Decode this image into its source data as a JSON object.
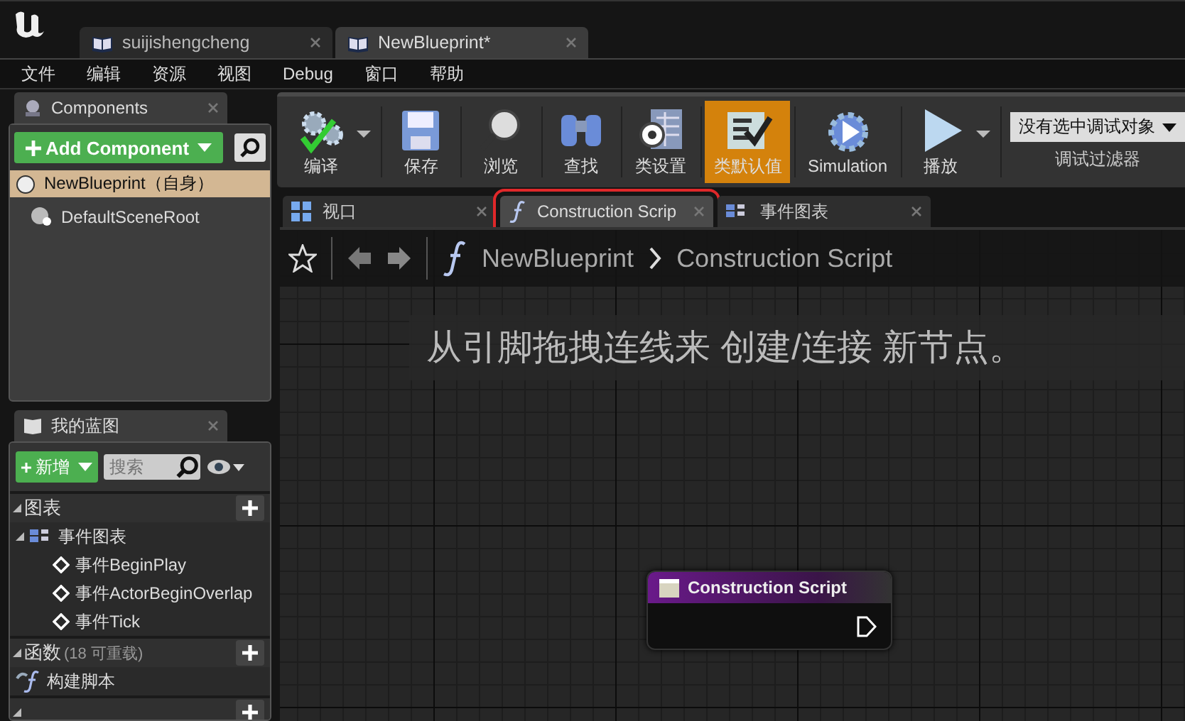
{
  "doc_tabs": [
    {
      "label": "suijishengcheng",
      "selected": false
    },
    {
      "label": "NewBlueprint*",
      "selected": true
    }
  ],
  "menu": [
    "文件",
    "编辑",
    "资源",
    "视图",
    "Debug",
    "窗口",
    "帮助"
  ],
  "components": {
    "title": "Components",
    "add_button": "Add Component",
    "items": [
      {
        "label": "NewBlueprint（自身）",
        "kind": "root",
        "selected": true
      },
      {
        "label": "DefaultSceneRoot",
        "kind": "scene",
        "selected": false
      }
    ]
  },
  "my_blueprint": {
    "title": "我的蓝图",
    "new_button": "新增",
    "search": {
      "placeholder": "搜索"
    },
    "sections": [
      {
        "title": "图表",
        "expanded": true,
        "children": [
          {
            "label": "事件图表",
            "kind": "graph",
            "expanded": true,
            "children": [
              {
                "label": "事件BeginPlay",
                "kind": "event"
              },
              {
                "label": "事件ActorBeginOverlap",
                "kind": "event"
              },
              {
                "label": "事件Tick",
                "kind": "event"
              }
            ]
          }
        ]
      },
      {
        "title": "函数",
        "note": "(18 可重载)",
        "expanded": true,
        "children": [
          {
            "label": "构建脚本",
            "kind": "function"
          }
        ]
      },
      {
        "expanded": true
      }
    ]
  },
  "toolbar": {
    "buttons": [
      {
        "label": "编译",
        "kind": "compile",
        "selected": false,
        "dropdown": true
      },
      {
        "label": "保存",
        "kind": "save",
        "selected": false,
        "dropdown": false
      },
      {
        "label": "浏览",
        "kind": "browse",
        "selected": false,
        "dropdown": false
      },
      {
        "label": "查找",
        "kind": "find",
        "selected": false,
        "dropdown": false
      },
      {
        "label": "类设置",
        "kind": "class-settings",
        "selected": false,
        "dropdown": false
      },
      {
        "label": "类默认值",
        "kind": "class-defaults",
        "selected": true,
        "dropdown": false
      },
      {
        "label": "Simulation",
        "kind": "simulation",
        "selected": false,
        "dropdown": false
      },
      {
        "label": "播放",
        "kind": "play",
        "selected": false,
        "dropdown": true
      }
    ],
    "debug_filter": {
      "value": "没有选中调试对象",
      "label": "调试过滤器"
    }
  },
  "graph_tabs": [
    {
      "label": "视口",
      "kind": "viewport",
      "selected": false,
      "highlighted": false
    },
    {
      "label": "Construction Scrip",
      "kind": "function",
      "selected": true,
      "highlighted": true
    },
    {
      "label": "事件图表",
      "kind": "graph",
      "selected": false,
      "highlighted": false
    }
  ],
  "breadcrumb": [
    "NewBlueprint",
    "Construction Script"
  ],
  "hint": "从引脚拖拽连线来 创建/连接 新节点。",
  "node": {
    "title": "Construction Script"
  }
}
